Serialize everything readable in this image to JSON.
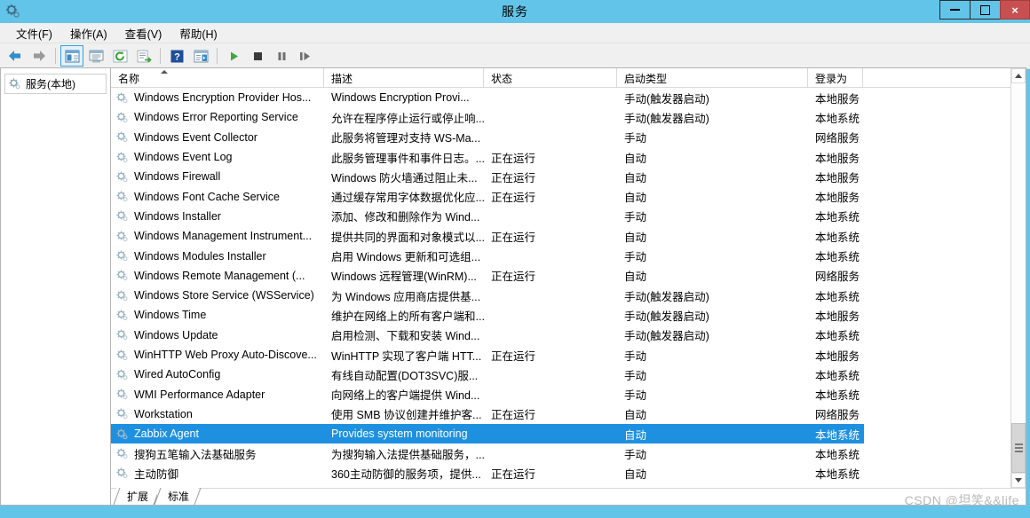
{
  "window": {
    "title": "服务",
    "icon": "services-gear-icon",
    "minimize_label": "最小化",
    "maximize_label": "最大化",
    "close_label": "×"
  },
  "menu": {
    "items": [
      {
        "label": "文件(F)",
        "name": "menu-file"
      },
      {
        "label": "操作(A)",
        "name": "menu-action"
      },
      {
        "label": "查看(V)",
        "name": "menu-view"
      },
      {
        "label": "帮助(H)",
        "name": "menu-help"
      }
    ]
  },
  "toolbar": {
    "buttons": [
      {
        "name": "back-icon",
        "glyph": "back"
      },
      {
        "name": "forward-icon",
        "glyph": "forward"
      },
      {
        "name": "show-hide-console-tree-icon",
        "glyph": "tree",
        "selected": true
      },
      {
        "name": "properties-icon",
        "glyph": "props"
      },
      {
        "name": "refresh-icon",
        "glyph": "refresh"
      },
      {
        "name": "export-list-icon",
        "glyph": "export"
      },
      {
        "name": "help-icon",
        "glyph": "help"
      },
      {
        "name": "show-action-pane-icon",
        "glyph": "pane"
      },
      {
        "name": "start-service-icon",
        "glyph": "play"
      },
      {
        "name": "stop-service-icon",
        "glyph": "stop"
      },
      {
        "name": "pause-service-icon",
        "glyph": "pause"
      },
      {
        "name": "restart-service-icon",
        "glyph": "restart"
      }
    ]
  },
  "tree": {
    "root_label": "服务(本地)"
  },
  "list": {
    "columns": [
      {
        "label": "名称",
        "name": "column-name",
        "sorted": true
      },
      {
        "label": "描述",
        "name": "column-description"
      },
      {
        "label": "状态",
        "name": "column-status"
      },
      {
        "label": "启动类型",
        "name": "column-startup-type"
      },
      {
        "label": "登录为",
        "name": "column-log-on-as"
      },
      {
        "label": "",
        "name": "column-filler"
      }
    ],
    "rows": [
      {
        "name": "Windows Encryption Provider Hos...",
        "description": "Windows Encryption Provi...",
        "status": "",
        "startup": "手动(触发器启动)",
        "logon": "本地服务",
        "selected": false
      },
      {
        "name": "Windows Error Reporting Service",
        "description": "允许在程序停止运行或停止响...",
        "status": "",
        "startup": "手动(触发器启动)",
        "logon": "本地系统",
        "selected": false
      },
      {
        "name": "Windows Event Collector",
        "description": "此服务将管理对支持 WS-Ma...",
        "status": "",
        "startup": "手动",
        "logon": "网络服务",
        "selected": false
      },
      {
        "name": "Windows Event Log",
        "description": "此服务管理事件和事件日志。...",
        "status": "正在运行",
        "startup": "自动",
        "logon": "本地服务",
        "selected": false
      },
      {
        "name": "Windows Firewall",
        "description": "Windows 防火墙通过阻止未...",
        "status": "正在运行",
        "startup": "自动",
        "logon": "本地服务",
        "selected": false
      },
      {
        "name": "Windows Font Cache Service",
        "description": "通过缓存常用字体数据优化应...",
        "status": "正在运行",
        "startup": "自动",
        "logon": "本地服务",
        "selected": false
      },
      {
        "name": "Windows Installer",
        "description": "添加、修改和删除作为 Wind...",
        "status": "",
        "startup": "手动",
        "logon": "本地系统",
        "selected": false
      },
      {
        "name": "Windows Management Instrument...",
        "description": "提供共同的界面和对象模式以...",
        "status": "正在运行",
        "startup": "自动",
        "logon": "本地系统",
        "selected": false
      },
      {
        "name": "Windows Modules Installer",
        "description": "启用 Windows 更新和可选组...",
        "status": "",
        "startup": "手动",
        "logon": "本地系统",
        "selected": false
      },
      {
        "name": "Windows Remote Management (...",
        "description": "Windows 远程管理(WinRM)...",
        "status": "正在运行",
        "startup": "自动",
        "logon": "网络服务",
        "selected": false
      },
      {
        "name": "Windows Store Service (WSService)",
        "description": "为 Windows 应用商店提供基...",
        "status": "",
        "startup": "手动(触发器启动)",
        "logon": "本地系统",
        "selected": false
      },
      {
        "name": "Windows Time",
        "description": "维护在网络上的所有客户端和...",
        "status": "",
        "startup": "手动(触发器启动)",
        "logon": "本地服务",
        "selected": false
      },
      {
        "name": "Windows Update",
        "description": "启用检测、下载和安装 Wind...",
        "status": "",
        "startup": "手动(触发器启动)",
        "logon": "本地系统",
        "selected": false
      },
      {
        "name": "WinHTTP Web Proxy Auto-Discove...",
        "description": "WinHTTP 实现了客户端 HTT...",
        "status": "正在运行",
        "startup": "手动",
        "logon": "本地服务",
        "selected": false
      },
      {
        "name": "Wired AutoConfig",
        "description": "有线自动配置(DOT3SVC)服...",
        "status": "",
        "startup": "手动",
        "logon": "本地系统",
        "selected": false
      },
      {
        "name": "WMI Performance Adapter",
        "description": "向网络上的客户端提供 Wind...",
        "status": "",
        "startup": "手动",
        "logon": "本地系统",
        "selected": false
      },
      {
        "name": "Workstation",
        "description": "使用 SMB 协议创建并维护客...",
        "status": "正在运行",
        "startup": "自动",
        "logon": "网络服务",
        "selected": false
      },
      {
        "name": "Zabbix Agent",
        "description": "Provides system monitoring",
        "status": "",
        "startup": "自动",
        "logon": "本地系统",
        "selected": true
      },
      {
        "name": "搜狗五笔输入法基础服务",
        "description": "为搜狗输入法提供基础服务，...",
        "status": "",
        "startup": "手动",
        "logon": "本地系统",
        "selected": false
      },
      {
        "name": "主动防御",
        "description": "360主动防御的服务项，提供...",
        "status": "正在运行",
        "startup": "自动",
        "logon": "本地系统",
        "selected": false
      }
    ]
  },
  "tabs": [
    {
      "label": "扩展",
      "name": "tab-extended"
    },
    {
      "label": "标准",
      "name": "tab-standard"
    }
  ],
  "watermark": "CSDN @坦笑&&life",
  "colors": {
    "title_bar": "#62c4e8",
    "selection": "#1e90e0",
    "close_button": "#c75050"
  }
}
